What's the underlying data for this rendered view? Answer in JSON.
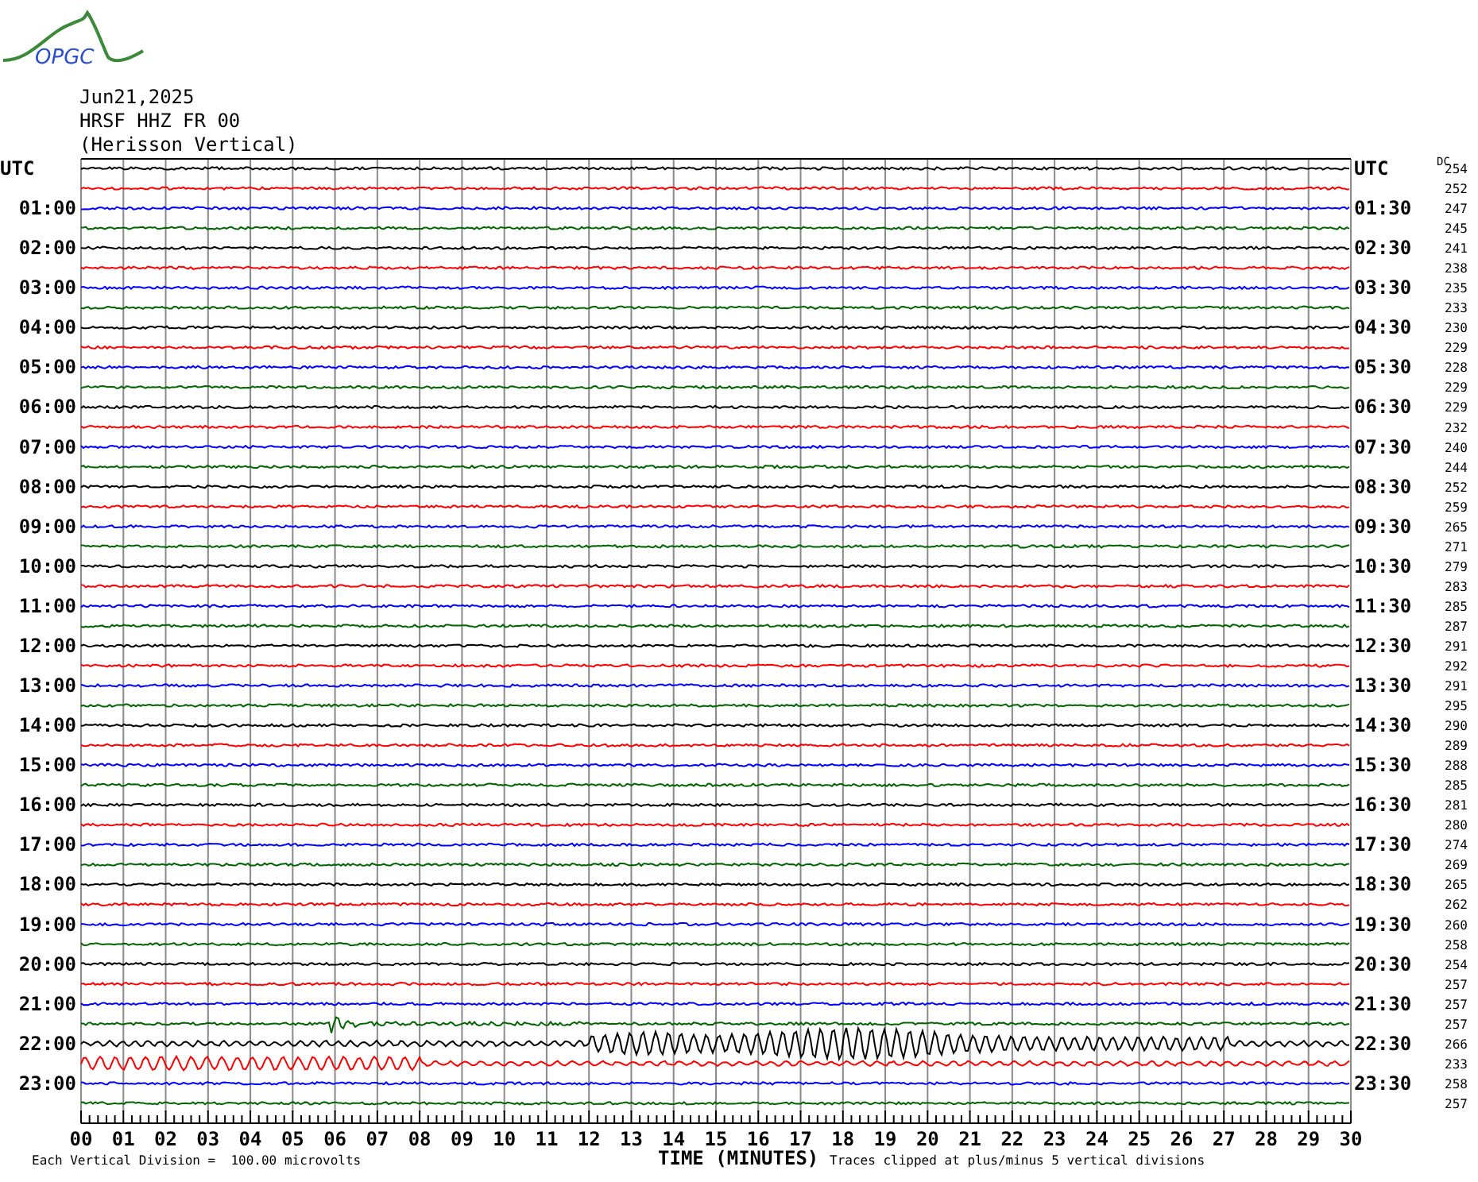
{
  "logo": {
    "text": "OPGC"
  },
  "header": {
    "date": "Jun21,2025",
    "station": "HRSF HHZ FR 00",
    "description": "(Herisson Vertical)"
  },
  "dc_header": "DC",
  "traces": [
    {
      "left": "UTC",
      "right": "UTC",
      "dc": "254",
      "color": "#000000",
      "kind": "quiet"
    },
    {
      "dc": "252",
      "color": "#ff0000",
      "kind": "quiet"
    },
    {
      "left": "01:00",
      "right": "01:30",
      "dc": "247",
      "color": "#0000ff",
      "kind": "quiet"
    },
    {
      "dc": "245",
      "color": "#006400",
      "kind": "quiet"
    },
    {
      "left": "02:00",
      "right": "02:30",
      "dc": "241",
      "color": "#000000",
      "kind": "quiet"
    },
    {
      "dc": "238",
      "color": "#ff0000",
      "kind": "quiet"
    },
    {
      "left": "03:00",
      "right": "03:30",
      "dc": "235",
      "color": "#0000ff",
      "kind": "quiet"
    },
    {
      "dc": "233",
      "color": "#006400",
      "kind": "quiet"
    },
    {
      "left": "04:00",
      "right": "04:30",
      "dc": "230",
      "color": "#000000",
      "kind": "quiet"
    },
    {
      "dc": "229",
      "color": "#ff0000",
      "kind": "quiet"
    },
    {
      "left": "05:00",
      "right": "05:30",
      "dc": "228",
      "color": "#0000ff",
      "kind": "quiet"
    },
    {
      "dc": "229",
      "color": "#006400",
      "kind": "quiet"
    },
    {
      "left": "06:00",
      "right": "06:30",
      "dc": "229",
      "color": "#000000",
      "kind": "quiet"
    },
    {
      "dc": "232",
      "color": "#ff0000",
      "kind": "quiet"
    },
    {
      "left": "07:00",
      "right": "07:30",
      "dc": "240",
      "color": "#0000ff",
      "kind": "quiet"
    },
    {
      "dc": "244",
      "color": "#006400",
      "kind": "quiet"
    },
    {
      "left": "08:00",
      "right": "08:30",
      "dc": "252",
      "color": "#000000",
      "kind": "quiet"
    },
    {
      "dc": "259",
      "color": "#ff0000",
      "kind": "quiet"
    },
    {
      "left": "09:00",
      "right": "09:30",
      "dc": "265",
      "color": "#0000ff",
      "kind": "quiet"
    },
    {
      "dc": "271",
      "color": "#006400",
      "kind": "quiet"
    },
    {
      "left": "10:00",
      "right": "10:30",
      "dc": "279",
      "color": "#000000",
      "kind": "quiet"
    },
    {
      "dc": "283",
      "color": "#ff0000",
      "kind": "quiet"
    },
    {
      "left": "11:00",
      "right": "11:30",
      "dc": "285",
      "color": "#0000ff",
      "kind": "quiet"
    },
    {
      "dc": "287",
      "color": "#006400",
      "kind": "quiet"
    },
    {
      "left": "12:00",
      "right": "12:30",
      "dc": "291",
      "color": "#000000",
      "kind": "quiet"
    },
    {
      "dc": "292",
      "color": "#ff0000",
      "kind": "quiet"
    },
    {
      "left": "13:00",
      "right": "13:30",
      "dc": "291",
      "color": "#0000ff",
      "kind": "quiet"
    },
    {
      "dc": "295",
      "color": "#006400",
      "kind": "quiet"
    },
    {
      "left": "14:00",
      "right": "14:30",
      "dc": "290",
      "color": "#000000",
      "kind": "quiet"
    },
    {
      "dc": "289",
      "color": "#ff0000",
      "kind": "quiet"
    },
    {
      "left": "15:00",
      "right": "15:30",
      "dc": "288",
      "color": "#0000ff",
      "kind": "quiet"
    },
    {
      "dc": "285",
      "color": "#006400",
      "kind": "quiet"
    },
    {
      "left": "16:00",
      "right": "16:30",
      "dc": "281",
      "color": "#000000",
      "kind": "quiet"
    },
    {
      "dc": "280",
      "color": "#ff0000",
      "kind": "quiet"
    },
    {
      "left": "17:00",
      "right": "17:30",
      "dc": "274",
      "color": "#0000ff",
      "kind": "quiet"
    },
    {
      "dc": "269",
      "color": "#006400",
      "kind": "quiet"
    },
    {
      "left": "18:00",
      "right": "18:30",
      "dc": "265",
      "color": "#000000",
      "kind": "quiet"
    },
    {
      "dc": "262",
      "color": "#ff0000",
      "kind": "quiet"
    },
    {
      "left": "19:00",
      "right": "19:30",
      "dc": "260",
      "color": "#0000ff",
      "kind": "quiet"
    },
    {
      "dc": "258",
      "color": "#006400",
      "kind": "quiet"
    },
    {
      "left": "20:00",
      "right": "20:30",
      "dc": "254",
      "color": "#000000",
      "kind": "quiet"
    },
    {
      "dc": "257",
      "color": "#ff0000",
      "kind": "quiet"
    },
    {
      "left": "21:00",
      "right": "21:30",
      "dc": "257",
      "color": "#0000ff",
      "kind": "quiet"
    },
    {
      "dc": "257",
      "color": "#006400",
      "kind": "onset"
    },
    {
      "left": "22:00",
      "right": "22:30",
      "dc": "266",
      "color": "#000000",
      "kind": "surface"
    },
    {
      "dc": "233",
      "color": "#ff0000",
      "kind": "ripple"
    },
    {
      "left": "23:00",
      "right": "23:30",
      "dc": "258",
      "color": "#0000ff",
      "kind": "quiet"
    },
    {
      "dc": "257",
      "color": "#006400",
      "kind": "quiet"
    }
  ],
  "x_axis": {
    "labels": [
      "00",
      "01",
      "02",
      "03",
      "04",
      "05",
      "06",
      "07",
      "08",
      "09",
      "10",
      "11",
      "12",
      "13",
      "14",
      "15",
      "16",
      "17",
      "18",
      "19",
      "20",
      "21",
      "22",
      "23",
      "24",
      "25",
      "26",
      "27",
      "28",
      "29",
      "30"
    ],
    "title": "TIME (MINUTES)"
  },
  "footer": {
    "division_note": "Each Vertical Division =  100.00 microvolts",
    "clip_note": "Traces clipped at plus/minus 5 vertical divisions"
  }
}
